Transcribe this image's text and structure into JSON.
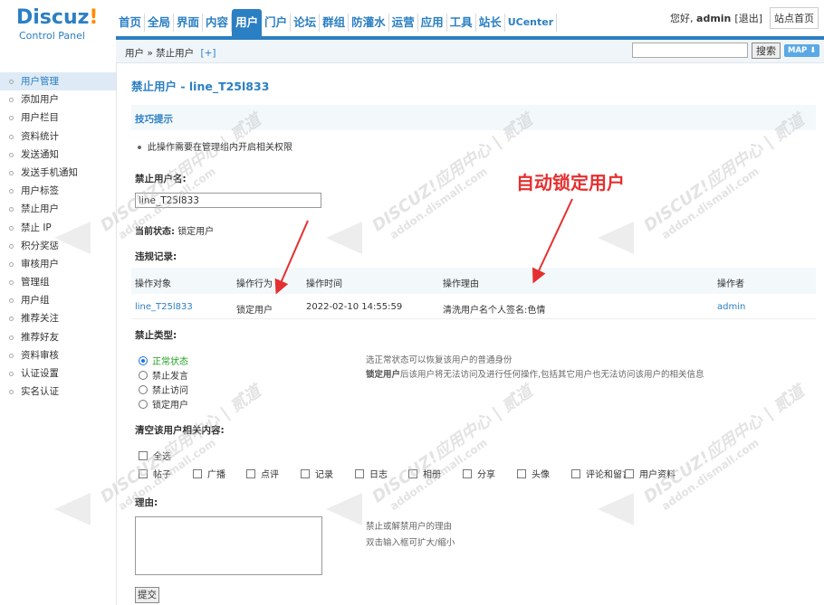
{
  "logo": {
    "main": "Discuz",
    "bang": "!",
    "sub": "Control Panel"
  },
  "topnav": {
    "items": [
      {
        "label": "首页",
        "active": false
      },
      {
        "label": "全局",
        "active": false
      },
      {
        "label": "界面",
        "active": false
      },
      {
        "label": "内容",
        "active": false
      },
      {
        "label": "用户",
        "active": true
      },
      {
        "label": "门户",
        "active": false
      },
      {
        "label": "论坛",
        "active": false
      },
      {
        "label": "群组",
        "active": false
      },
      {
        "label": "防灌水",
        "active": false
      },
      {
        "label": "运营",
        "active": false
      },
      {
        "label": "应用",
        "active": false
      },
      {
        "label": "工具",
        "active": false
      },
      {
        "label": "站长",
        "active": false
      },
      {
        "label": "UCenter",
        "active": false
      }
    ]
  },
  "topright": {
    "hello": "您好,",
    "user": "admin",
    "logout": "[退出]",
    "home": "站点首页"
  },
  "subbar": {
    "crumb_a": "用户",
    "crumb_sep": "»",
    "crumb_b": "禁止用户",
    "crumb_plus": "[+]",
    "search_btn": "搜索",
    "map_btn": "MAP ⬇"
  },
  "sidebar": {
    "items": [
      {
        "label": "用户管理",
        "active": true
      },
      {
        "label": "添加用户",
        "active": false
      },
      {
        "label": "用户栏目",
        "active": false
      },
      {
        "label": "资料统计",
        "active": false
      },
      {
        "label": "发送通知",
        "active": false
      },
      {
        "label": "发送手机通知",
        "active": false
      },
      {
        "label": "用户标签",
        "active": false
      },
      {
        "label": "禁止用户",
        "active": false
      },
      {
        "label": "禁止 IP",
        "active": false
      },
      {
        "label": "积分奖惩",
        "active": false
      },
      {
        "label": "审核用户",
        "active": false
      },
      {
        "label": "管理组",
        "active": false
      },
      {
        "label": "用户组",
        "active": false
      },
      {
        "label": "推荐关注",
        "active": false
      },
      {
        "label": "推荐好友",
        "active": false
      },
      {
        "label": "资料审核",
        "active": false
      },
      {
        "label": "认证设置",
        "active": false
      },
      {
        "label": "实名认证",
        "active": false
      }
    ]
  },
  "main": {
    "title": "禁止用户 - line_T25l833",
    "tips_title": "技巧提示",
    "tip": "此操作需要在管理组内开启相关权限",
    "username_label": "禁止用户名:",
    "username_value": "line_T25l833",
    "status_label": "当前状态:",
    "status_value": "锁定用户",
    "records_label": "违规记录:",
    "records": {
      "headers": [
        "操作对象",
        "操作行为",
        "操作时间",
        "操作理由",
        "操作者"
      ],
      "rows": [
        [
          "line_T25l833",
          "锁定用户",
          "2022-02-10 14:55:59",
          "清洗用户名个人签名:色情",
          "admin"
        ]
      ]
    },
    "ban_type_label": "禁止类型:",
    "ban_types": [
      "正常状态",
      "禁止发言",
      "禁止访问",
      "锁定用户"
    ],
    "hint_normal": "选正常状态可以恢复该用户的普通身份",
    "hint_lock_b": "锁定用户",
    "hint_lock_rest": "后该用户将无法访问及进行任何操作,包括其它用户也无法访问该用户的相关信息",
    "clear_label": "清空该用户相关内容:",
    "select_all": "全选",
    "clear_items": [
      "帖子",
      "广播",
      "点评",
      "记录",
      "日志",
      "相册",
      "分享",
      "头像",
      "评论和留言",
      "用户资料"
    ],
    "reason_label": "理由:",
    "reason_hint1": "禁止或解禁用户的理由",
    "reason_hint2": "双击输入框可扩大/缩小",
    "submit": "提交"
  },
  "annotation": "自动锁定用户",
  "watermark": {
    "brand": "DISCUZ!应用中心 | 贰道",
    "url": "addon.dismall.com"
  },
  "colors": {
    "accent": "#2b7fc3",
    "annotation": "#e53030",
    "normal_state": "#22a022"
  }
}
